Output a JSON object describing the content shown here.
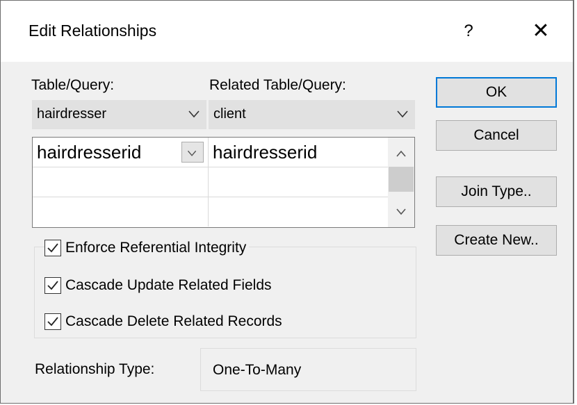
{
  "dialog": {
    "title": "Edit Relationships",
    "help_label": "?",
    "close_label": "✕"
  },
  "table_query": {
    "label": "Table/Query:",
    "value": "hairdresser"
  },
  "related_table_query": {
    "label": "Related Table/Query:",
    "value": "client"
  },
  "fields_grid": {
    "rows": [
      {
        "left": "hairdresserid",
        "right": "hairdresserid"
      },
      {
        "left": "",
        "right": ""
      },
      {
        "left": "",
        "right": ""
      }
    ]
  },
  "options": {
    "enforce_integrity": {
      "label": "Enforce Referential Integrity",
      "checked": true
    },
    "cascade_update": {
      "label": "Cascade Update Related Fields",
      "checked": true
    },
    "cascade_delete": {
      "label": "Cascade Delete Related Records",
      "checked": true
    }
  },
  "relationship_type": {
    "label": "Relationship Type:",
    "value": "One-To-Many"
  },
  "buttons": {
    "ok": "OK",
    "cancel": "Cancel",
    "join_type": "Join Type..",
    "create_new": "Create New.."
  },
  "colors": {
    "accent": "#0078d7",
    "dialog_bg": "#f0f0f0",
    "combo_bg": "#e1e1e1"
  },
  "icons": {
    "close": "close-icon",
    "help": "help-icon",
    "dropdown": "chevron-down-icon",
    "scroll_up": "chevron-up-icon",
    "scroll_down": "chevron-down-icon",
    "check": "checkmark-icon"
  }
}
